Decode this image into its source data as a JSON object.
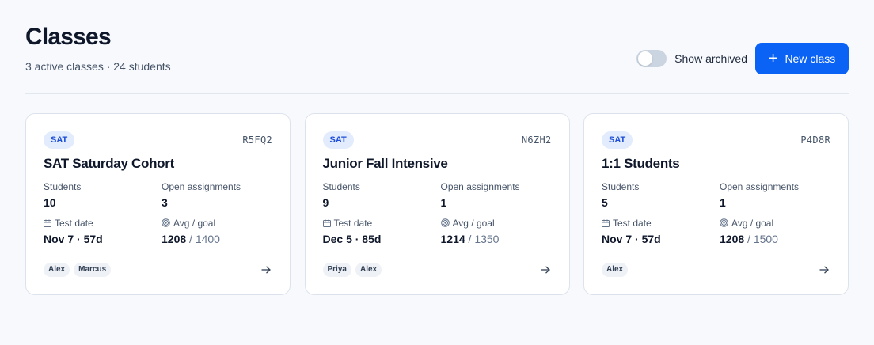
{
  "header": {
    "title": "Classes",
    "subtitle": "3 active classes · 24 students",
    "show_archived_label": "Show archived",
    "show_archived_on": false,
    "new_class_label": "New class"
  },
  "colors": {
    "accent": "#0b63f6",
    "badge_bg": "#e3ecfd",
    "badge_text": "#1d4ed8"
  },
  "classes": [
    {
      "badge": "SAT",
      "code": "R5FQ2",
      "name": "SAT Saturday Cohort",
      "students_label": "Students",
      "students": "10",
      "open_label": "Open assignments",
      "open": "3",
      "test_label": "Test date",
      "test_date": "Nov 7 · 57d",
      "avg_label": "Avg / goal",
      "avg": "1208",
      "goal": "/ 1400",
      "tutors": [
        "Alex",
        "Marcus"
      ]
    },
    {
      "badge": "SAT",
      "code": "N6ZH2",
      "name": "Junior Fall Intensive",
      "students_label": "Students",
      "students": "9",
      "open_label": "Open assignments",
      "open": "1",
      "test_label": "Test date",
      "test_date": "Dec 5 · 85d",
      "avg_label": "Avg / goal",
      "avg": "1214",
      "goal": "/ 1350",
      "tutors": [
        "Priya",
        "Alex"
      ]
    },
    {
      "badge": "SAT",
      "code": "P4D8R",
      "name": "1:1 Students",
      "students_label": "Students",
      "students": "5",
      "open_label": "Open assignments",
      "open": "1",
      "test_label": "Test date",
      "test_date": "Nov 7 · 57d",
      "avg_label": "Avg / goal",
      "avg": "1208",
      "goal": "/ 1500",
      "tutors": [
        "Alex"
      ]
    }
  ],
  "icons": {
    "new_class": "plus-icon",
    "test_date": "calendar-icon",
    "avg_goal": "target-icon",
    "open_card": "arrow-right-icon"
  }
}
